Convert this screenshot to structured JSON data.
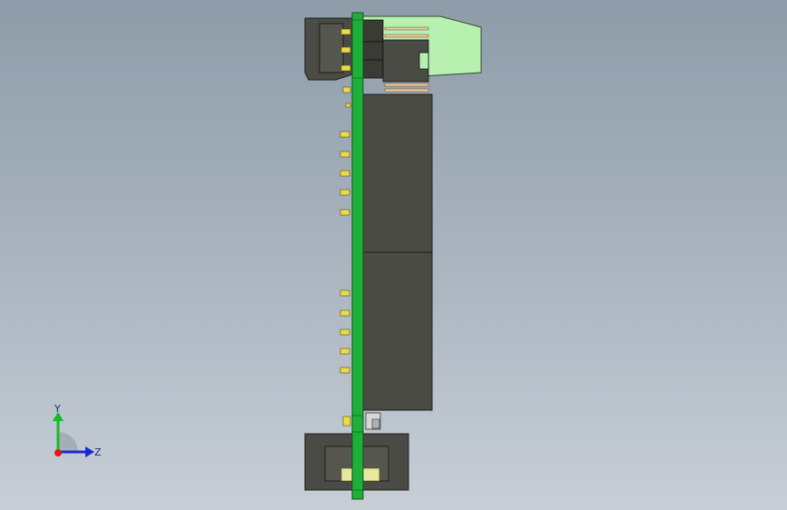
{
  "viewport": {
    "background_top": "#8e9ca9",
    "background_bottom": "#c7ced6"
  },
  "model": {
    "pcb_color": "#1fae3a",
    "connector_color": "#b8f0b0",
    "component_color": "#4a4b44",
    "pin_color": "#e8dc4a"
  },
  "triad": {
    "y_label": "Y",
    "z_label": "Z",
    "y_color": "#19b82a",
    "z_color": "#1a2ad0",
    "origin_color": "#e01818"
  }
}
